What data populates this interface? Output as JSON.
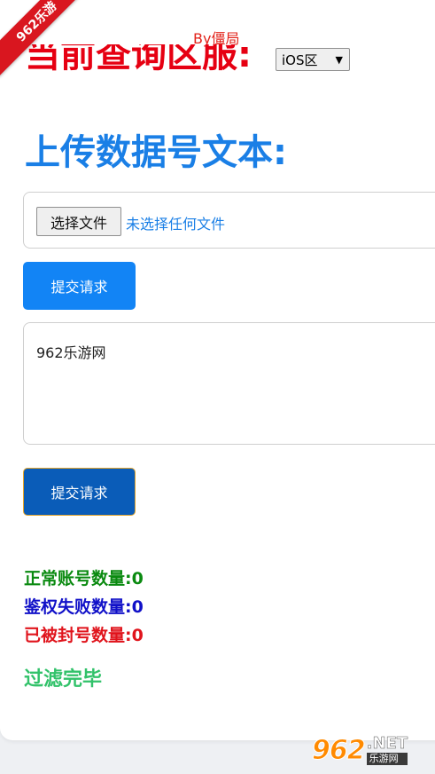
{
  "header": {
    "author": "By僵局",
    "region_title": "当前查询区服:",
    "region_select": {
      "selected": "iOS区",
      "caret": "▼"
    }
  },
  "upload": {
    "title": "上传数据号文本:",
    "file_button_label": "选择文件",
    "file_status": "未选择任何文件",
    "submit_label": "提交请求"
  },
  "text_form": {
    "textarea_value": "962乐游网",
    "submit_label": "提交请求"
  },
  "stats": {
    "normal_label": "正常账号数量:",
    "normal_count": "0",
    "auth_fail_label": "鉴权失败数量:",
    "auth_fail_count": "0",
    "banned_label": "已被封号数量:",
    "banned_count": "0",
    "status_text": "过滤完毕"
  },
  "overlay": {
    "corner_ribbon": "962乐游",
    "watermark_digits": "962",
    "watermark_net": ".NET",
    "watermark_cn": "乐游网"
  },
  "colors": {
    "region_title": "#e60012",
    "upload_title": "#1a7fe6",
    "submit_primary": "#1284f5",
    "submit_focused": "#0a5cb8",
    "stat_normal": "#0a8a10",
    "stat_auth_fail": "#1010c8",
    "stat_banned": "#e0141c",
    "status_done": "#32c26a"
  }
}
